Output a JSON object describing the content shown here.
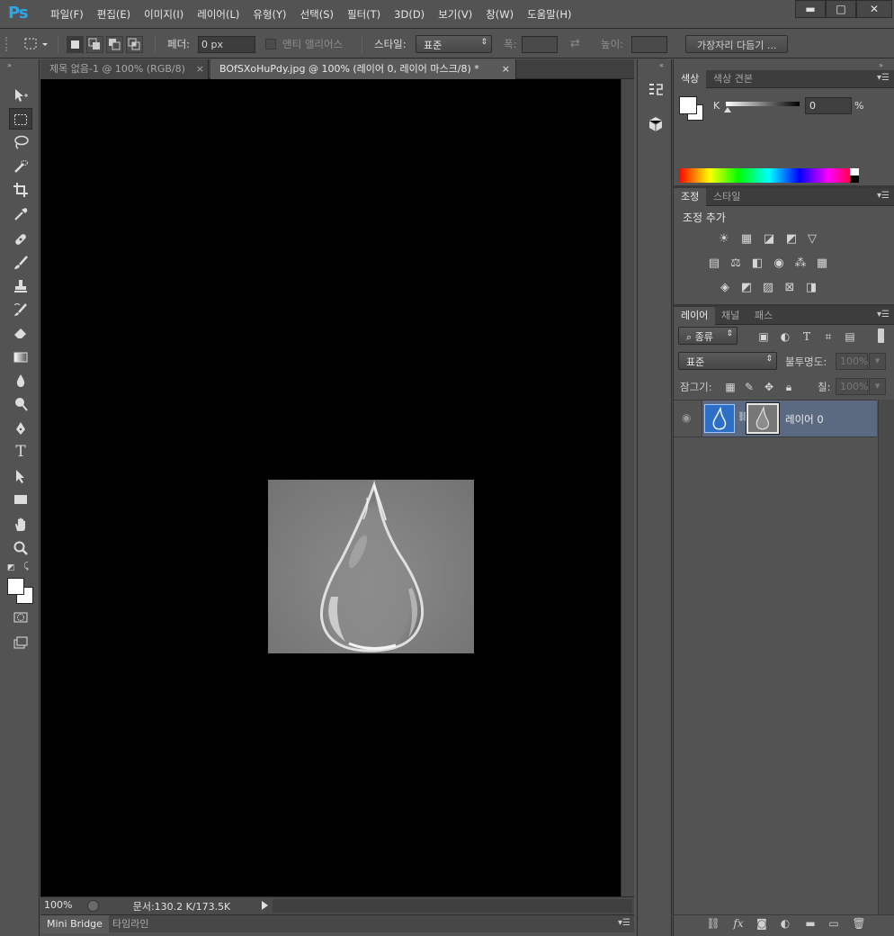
{
  "app": {
    "logo": "Ps"
  },
  "menu": [
    "파일(F)",
    "편집(E)",
    "이미지(I)",
    "레이어(L)",
    "유형(Y)",
    "선택(S)",
    "필터(T)",
    "3D(D)",
    "보기(V)",
    "창(W)",
    "도움말(H)"
  ],
  "window_controls": {
    "minimize": "▬",
    "maximize": "□",
    "close": "✕"
  },
  "options": {
    "feather_label": "페더:",
    "feather_value": "0 px",
    "antialias_label": "앤티 앨리어스",
    "style_label": "스타일:",
    "style_value": "표준",
    "width_label": "폭:",
    "height_label": "높이:",
    "refine_edge": "가장자리 다듬기 ..."
  },
  "tabs": [
    {
      "label": "제목 없음-1 @ 100% (RGB/8)",
      "close": "×"
    },
    {
      "label": "BOfSXoHuPdy.jpg @ 100% (레이어 0, 레이어 마스크/8) *",
      "close": "×"
    }
  ],
  "status": {
    "zoom": "100%",
    "doc_info": "문서:130.2 K/173.5K"
  },
  "bottom_tabs": [
    "Mini Bridge",
    "타임라인"
  ],
  "color_panel": {
    "tabs": [
      "색상",
      "색상 견본"
    ],
    "channel_label": "K",
    "value": "0",
    "unit": "%"
  },
  "adjust_panel": {
    "tabs": [
      "조정",
      "스타일"
    ],
    "title": "조정 추가"
  },
  "layers_panel": {
    "tabs": [
      "레이어",
      "채널",
      "패스"
    ],
    "filter_kind": "종류",
    "blend_mode": "표준",
    "opacity_label": "불투명도:",
    "opacity_value": "100%",
    "lock_label": "잠그기:",
    "fill_label": "칠:",
    "fill_value": "100%",
    "layers": [
      {
        "name": "레이어 0",
        "visible": true
      }
    ]
  },
  "colors": {
    "background": "#535353",
    "canvas": "#000000",
    "accent": "#30a6e6",
    "layer_selected": "#5b6a80"
  }
}
